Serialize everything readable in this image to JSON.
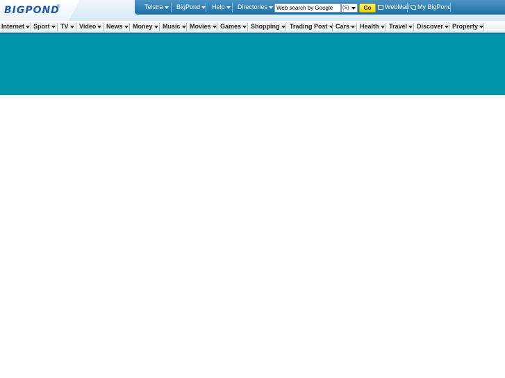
{
  "header": {
    "logo_text": "BIGPOND",
    "logo_reg": "®"
  },
  "utility": {
    "telstra": "Telstra",
    "bigpond": "BigPond",
    "help": "Help",
    "directories": "Directories",
    "search_placeholder": "Web search by Google",
    "search_scope": "(S)",
    "go_label": "Go",
    "webmail": "WebMail",
    "my_bigpond": "My BigPond"
  },
  "nav": {
    "items": [
      "Internet",
      "Sport",
      "TV",
      "Video",
      "News",
      "Money",
      "Music",
      "Movies",
      "Games",
      "Shopping",
      "Trading Post",
      "Cars",
      "Health",
      "Travel",
      "Discover",
      "Property"
    ]
  },
  "colors": {
    "banner": "#0096aa",
    "utility_bar": "#1f6fa6",
    "go_button": "#f1d400",
    "logo": "#1f5aa8"
  }
}
